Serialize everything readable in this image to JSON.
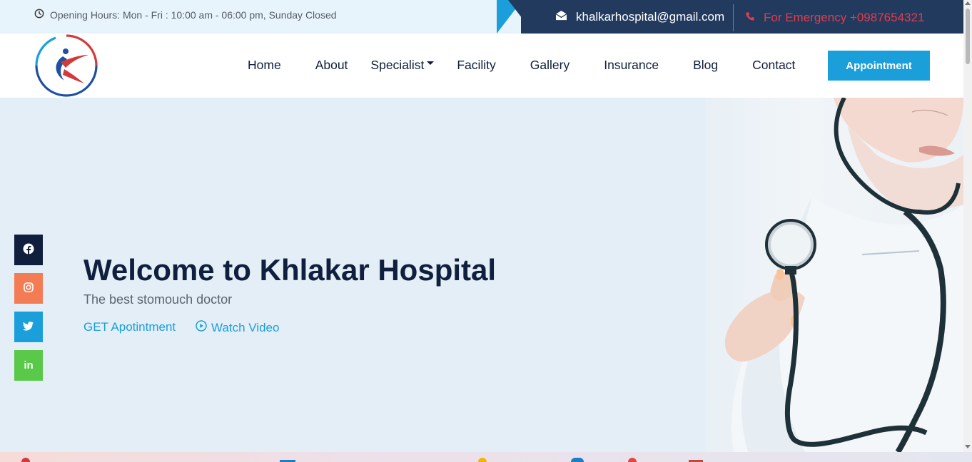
{
  "topbar": {
    "opening_hours": "Opening Hours: Mon - Fri : 10:00 am - 06:00 pm, Sunday Closed",
    "email": "khalkarhospital@gmail.com",
    "emergency": "For Emergency +0987654321"
  },
  "nav": {
    "items": [
      {
        "label": "Home"
      },
      {
        "label": "About"
      },
      {
        "label": "Specialist",
        "dropdown": true
      },
      {
        "label": "Facility"
      },
      {
        "label": "Gallery"
      },
      {
        "label": "Insurance"
      },
      {
        "label": "Blog"
      },
      {
        "label": "Contact"
      }
    ],
    "appointment_label": "Appointment"
  },
  "hero": {
    "title": "Welcome to Khlakar Hospital",
    "subtitle": "The best stomouch doctor",
    "cta_primary": "GET Apotintment",
    "cta_video": "Watch Video"
  },
  "social": {
    "items": [
      {
        "name": "facebook",
        "icon": "facebook-icon",
        "color": "#0f1f3d"
      },
      {
        "name": "instagram",
        "icon": "instagram-icon",
        "color": "#f47c55"
      },
      {
        "name": "twitter",
        "icon": "twitter-icon",
        "color": "#1a9fdb"
      },
      {
        "name": "linkedin",
        "icon": "linkedin-icon",
        "label": "in",
        "color": "#5ac94a"
      }
    ]
  },
  "colors": {
    "accent": "#1a9fdb",
    "navy": "#0f1f3d",
    "emergency": "#e23b4b",
    "topbar_dark": "#223a5e"
  }
}
